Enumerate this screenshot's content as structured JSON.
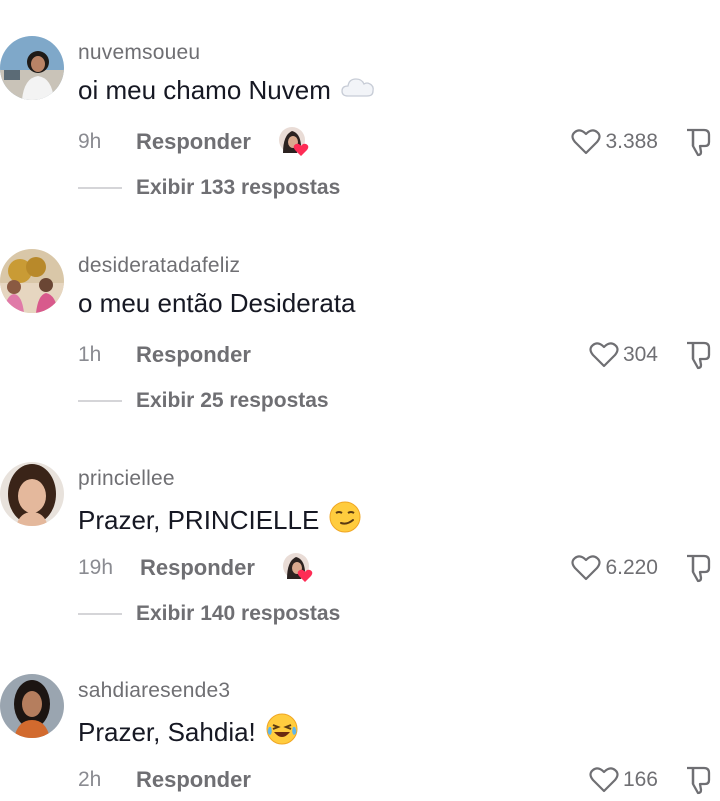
{
  "comments": [
    {
      "username": "nuvemsoueu",
      "text": "oi meu chamo Nuvem",
      "emoji_icon": "cloud-icon",
      "time": "9h",
      "reply_label": "Responder",
      "liked_by_creator": true,
      "likes": "3.388",
      "view_replies": "Exibir 133 respostas"
    },
    {
      "username": "desideratadafeliz",
      "text": "o meu então Desiderata",
      "emoji_icon": "",
      "time": "1h",
      "reply_label": "Responder",
      "liked_by_creator": false,
      "likes": "304",
      "view_replies": "Exibir 25 respostas"
    },
    {
      "username": "princiellee",
      "text": "Prazer, PRINCIELLE",
      "emoji_icon": "smirk-face-icon",
      "time": "19h",
      "reply_label": "Responder",
      "liked_by_creator": true,
      "likes": "6.220",
      "view_replies": "Exibir 140 respostas"
    },
    {
      "username": "sahdiaresende3",
      "text": "Prazer, Sahdia!",
      "emoji_icon": "laughing-tears-icon",
      "time": "2h",
      "reply_label": "Responder",
      "liked_by_creator": false,
      "likes": "166",
      "view_replies": ""
    }
  ],
  "colors": {
    "text": "#161823",
    "muted": "#6f6f73",
    "heart_red": "#fe2c55"
  }
}
